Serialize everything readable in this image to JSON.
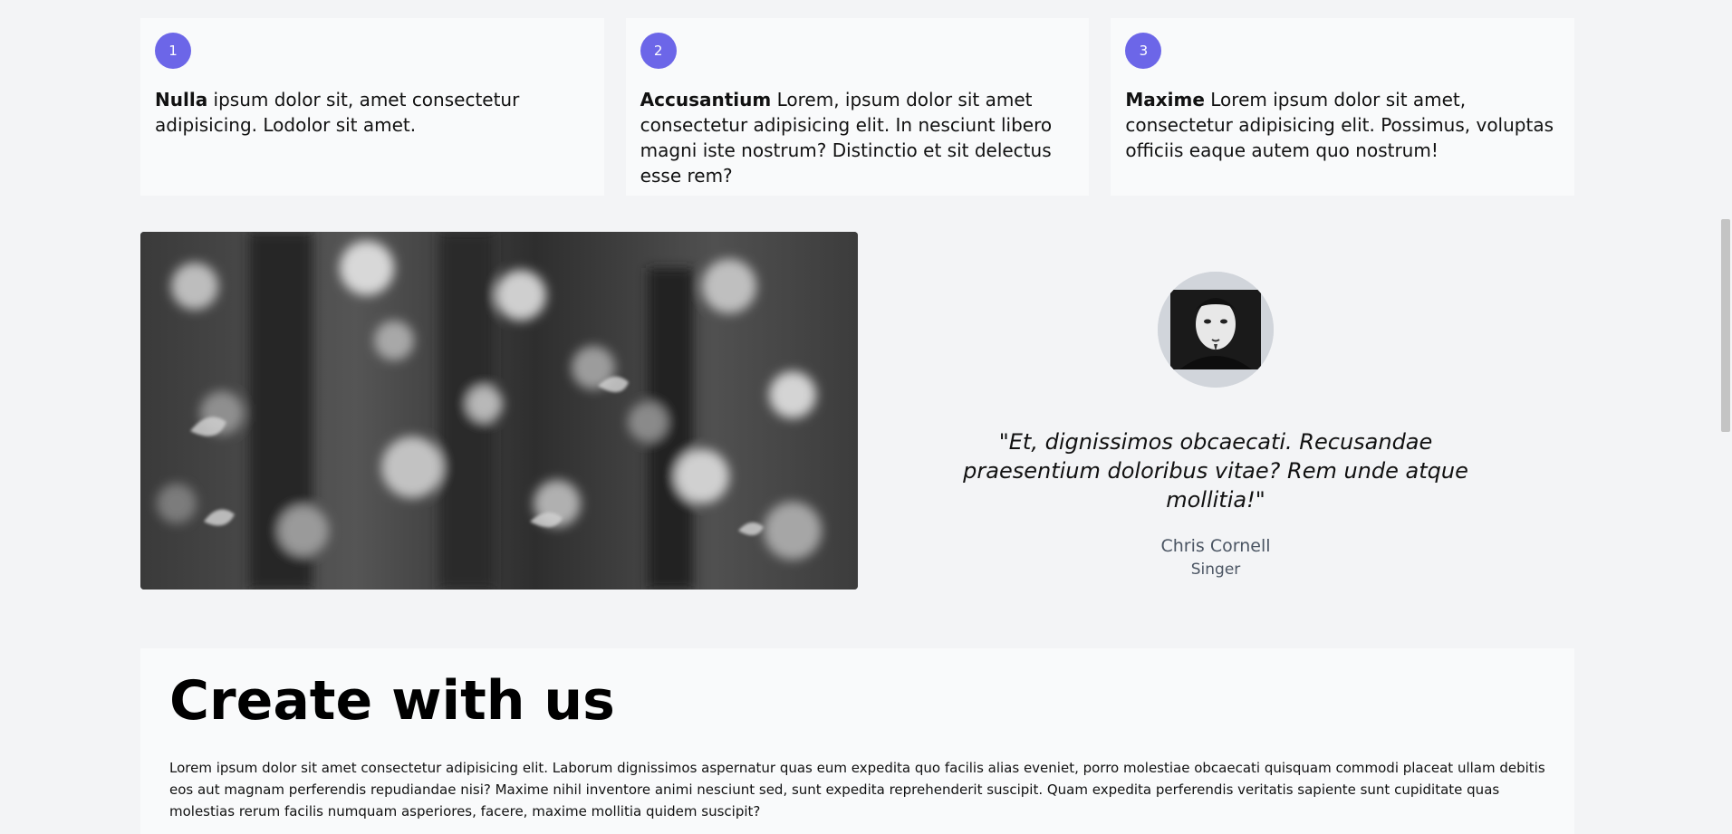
{
  "features": [
    {
      "number": "1",
      "title": "Nulla",
      "text": "ipsum dolor sit, amet consectetur adipisicing. Lodolor sit amet."
    },
    {
      "number": "2",
      "title": "Accusantium",
      "text": "Lorem, ipsum dolor sit amet consectetur adipisicing elit. In nesciunt libero magni iste nostrum? Distinctio et sit delectus esse rem?"
    },
    {
      "number": "3",
      "title": "Maxime",
      "text": "Lorem ipsum dolor sit amet, consectetur adipisicing elit. Possimus, voluptas officiis eaque autem quo nostrum!"
    }
  ],
  "testimonial": {
    "quote": "\"Et, dignissimos obcaecati. Recusandae praesentium doloribus vitae? Rem unde atque mollitia!\"",
    "name": "Chris Cornell",
    "role": "Singer"
  },
  "create": {
    "heading": "Create with us",
    "body": "Lorem ipsum dolor sit amet consectetur adipisicing elit. Laborum dignissimos aspernatur quas eum expedita quo facilis alias eveniet, porro molestiae obcaecati quisquam commodi placeat ullam debitis eos aut magnam perferendis repudiandae nisi? Maxime nihil inventore animi nesciunt sed, sunt expedita reprehenderit suscipit. Quam expedita perferendis veritatis sapiente sunt cupiditate quas molestias rerum facilis numquam asperiores, facere, maxime mollitia quidem suscipit?"
  },
  "colors": {
    "badge": "#6c66e8",
    "page_background": "#f3f4f6",
    "card_background": "#f9fafb"
  },
  "icons": {
    "photo": "blurred-leaves-image",
    "avatar": "person-portrait-avatar"
  }
}
